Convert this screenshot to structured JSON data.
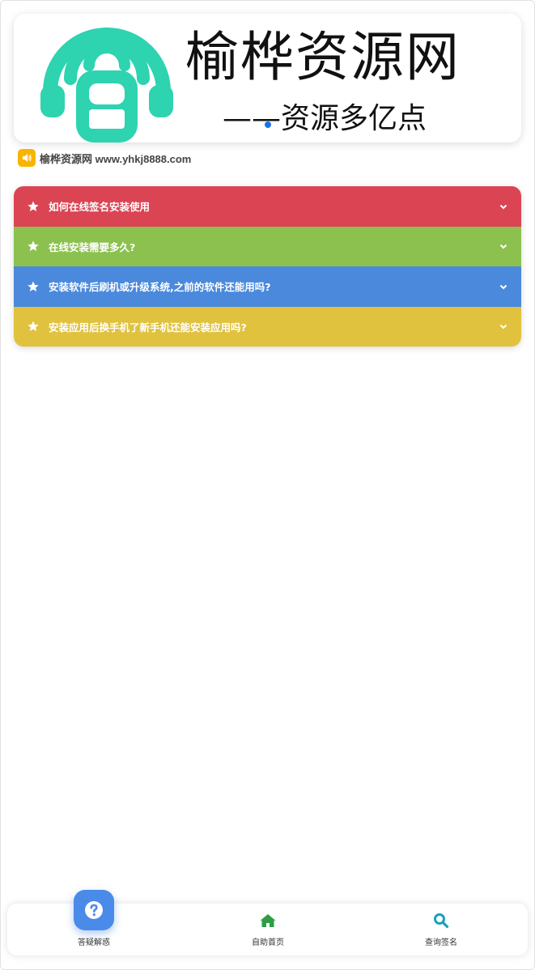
{
  "banner": {
    "title": "榆桦资源网",
    "slogan": "——资源多亿点",
    "logo_color": "#2ed3b0"
  },
  "notice": {
    "icon": "speaker-icon",
    "text": "榆桦资源网 www.yhkj8888.com"
  },
  "faq": {
    "items": [
      {
        "question": "如何在线签名安装使用",
        "color": "#db4453"
      },
      {
        "question": "在线安装需要多久?",
        "color": "#8cc14f"
      },
      {
        "question": "安装软件后刷机或升级系统,之前的软件还能用吗?",
        "color": "#4a89dc"
      },
      {
        "question": "安装应用后换手机了新手机还能安装应用吗?",
        "color": "#e0c23f"
      }
    ]
  },
  "tabbar": {
    "tabs": [
      {
        "label": "答疑解惑",
        "icon": "question-icon",
        "color": "#4a8ae8"
      },
      {
        "label": "自助首页",
        "icon": "home-icon",
        "color": "#2e9e46"
      },
      {
        "label": "查询签名",
        "icon": "search-icon",
        "color": "#1aa0b8"
      }
    ]
  }
}
